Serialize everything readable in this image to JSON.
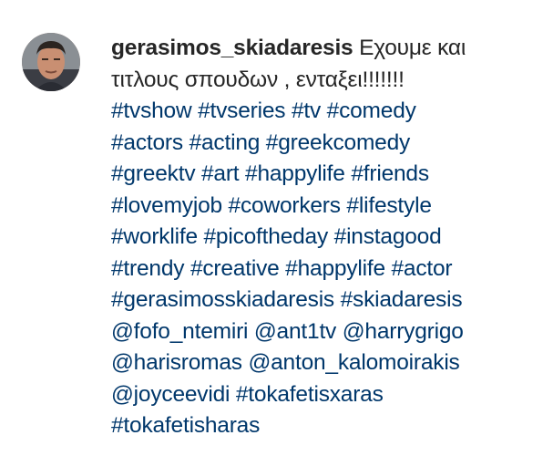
{
  "comment": {
    "username": "gerasimos_skiadaresis",
    "text_line1": "Εχουμε και",
    "text_line2": "τιτλους σπουδων , ενταξει!!!!!!!",
    "lines": [
      [
        "#tvshow",
        "#tvseries",
        "#tv",
        "#comedy"
      ],
      [
        "#actors",
        "#acting",
        "#greekcomedy"
      ],
      [
        "#greektv",
        "#art",
        "#happylife",
        "#friends"
      ],
      [
        "#lovemyjob",
        "#coworkers",
        "#lifestyle"
      ],
      [
        "#worklife",
        "#picoftheday",
        "#instagood"
      ],
      [
        "#trendy",
        "#creative",
        "#happylife",
        "#actor"
      ],
      [
        "#gerasimosskiadaresis",
        "#skiadaresis"
      ],
      [
        "@fofo_ntemiri",
        "@ant1tv",
        "@harrygrigo"
      ],
      [
        "@harisromas",
        "@anton_kalomoirakis"
      ],
      [
        "@joyceevidi",
        "#tokafetisxaras"
      ],
      [
        "#tokafetisharas"
      ]
    ]
  },
  "colors": {
    "text": "#262626",
    "link": "#00376b",
    "background": "#ffffff"
  }
}
